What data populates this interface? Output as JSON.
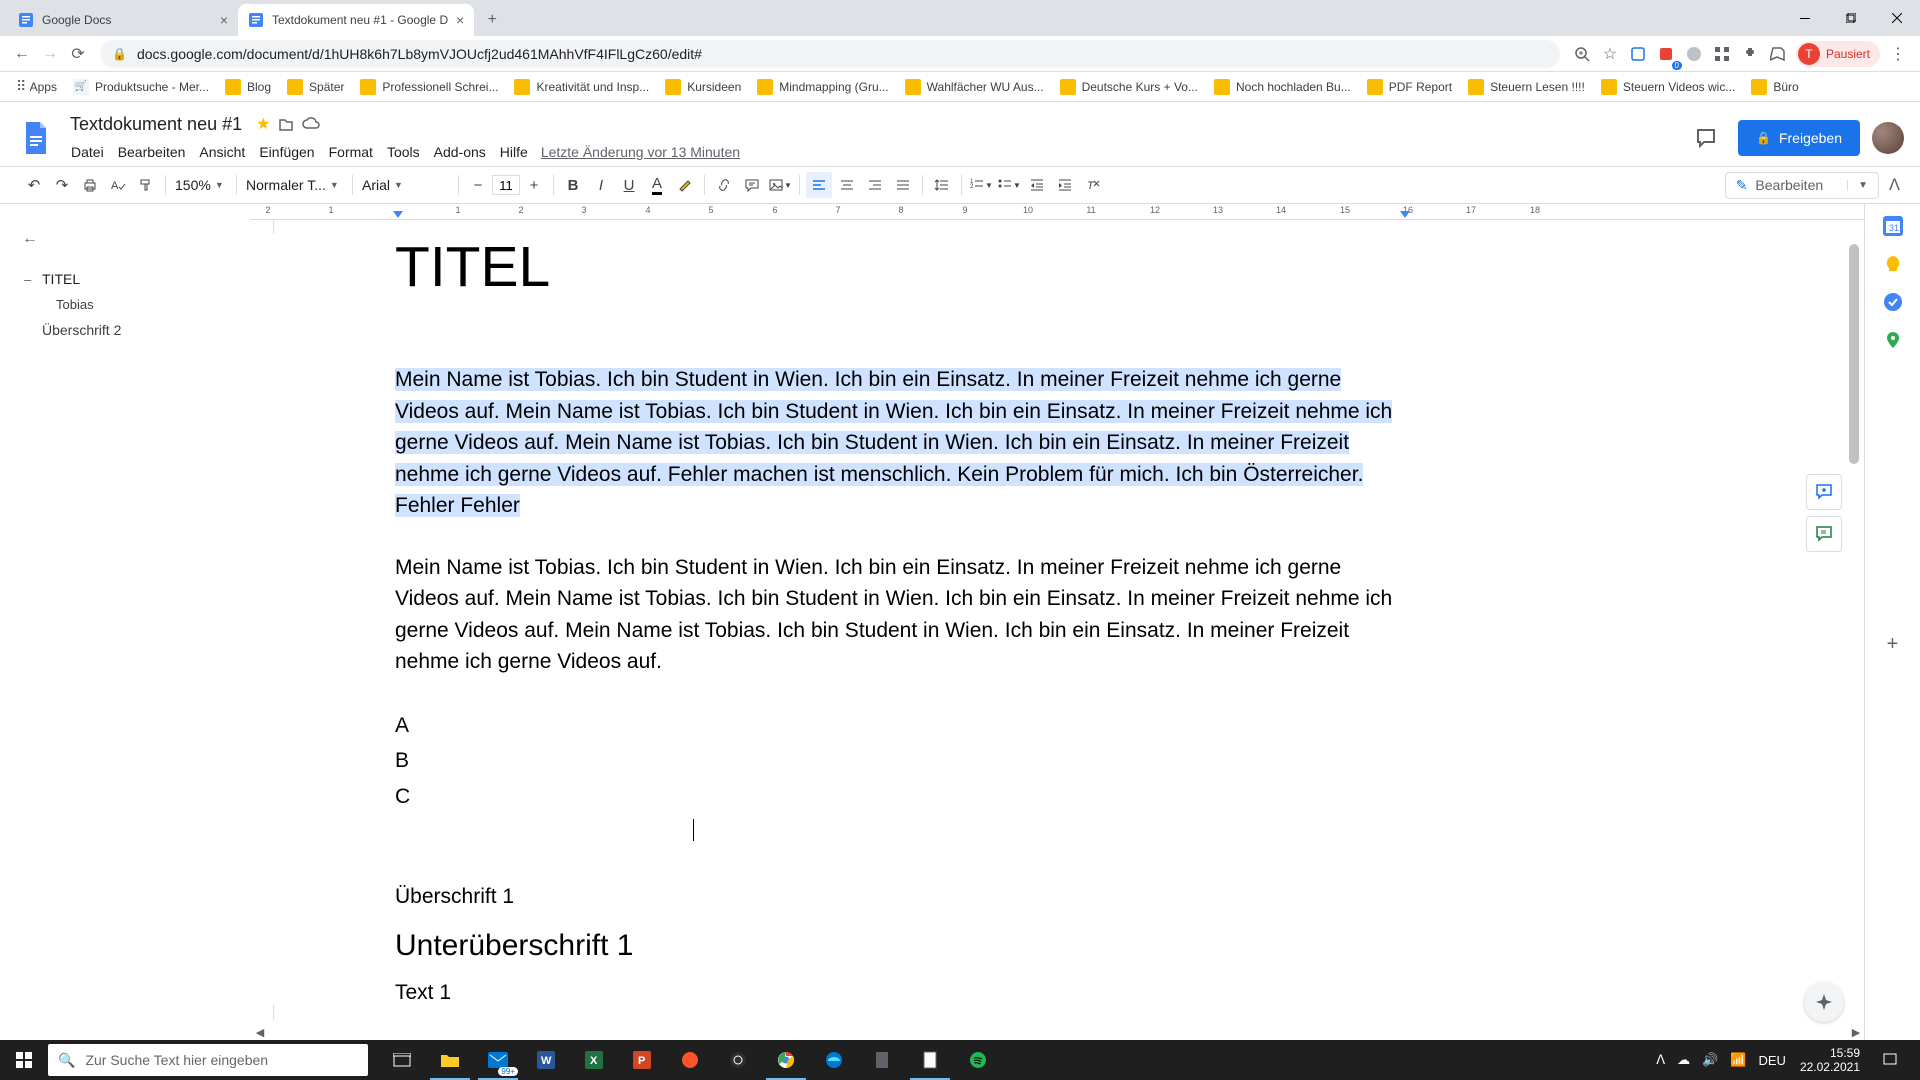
{
  "browser": {
    "tabs": [
      {
        "title": "Google Docs",
        "active": false
      },
      {
        "title": "Textdokument neu #1 - Google D",
        "active": true
      }
    ],
    "url": "docs.google.com/document/d/1hUH8k6h7Lb8ymVJOUcfj2ud461MAhhVfF4IFlLgCz60/edit#",
    "profile_label": "Pausiert",
    "profile_initial": "T"
  },
  "bookmarks": [
    "Apps",
    "Produktsuche - Mer...",
    "Blog",
    "Später",
    "Professionell Schrei...",
    "Kreativität und Insp...",
    "Kursideen",
    "Mindmapping  (Gru...",
    "Wahlfächer WU Aus...",
    "Deutsche Kurs + Vo...",
    "Noch hochladen Bu...",
    "PDF Report",
    "Steuern Lesen !!!!",
    "Steuern Videos wic...",
    "Büro"
  ],
  "docs": {
    "filename": "Textdokument neu #1",
    "share_label": "Freigeben",
    "last_edit": "Letzte Änderung vor 13 Minuten",
    "menus": [
      "Datei",
      "Bearbeiten",
      "Ansicht",
      "Einfügen",
      "Format",
      "Tools",
      "Add-ons",
      "Hilfe"
    ]
  },
  "toolbar": {
    "zoom": "150%",
    "style": "Normaler T...",
    "font": "Arial",
    "font_size": "11",
    "edit_mode": "Bearbeiten"
  },
  "outline": {
    "items": [
      {
        "label": "TITEL",
        "level": 1,
        "expanded": true
      },
      {
        "label": "Tobias",
        "level": 2
      },
      {
        "label": "Überschrift 2",
        "level": 1
      }
    ]
  },
  "ruler": {
    "nums": [
      "2",
      "1",
      "1",
      "2",
      "3",
      "4",
      "5",
      "6",
      "7",
      "8",
      "9",
      "10",
      "11",
      "12",
      "13",
      "14",
      "15",
      "16",
      "17",
      "18"
    ]
  },
  "document": {
    "title": "TITEL",
    "para1": "Mein Name ist Tobias. Ich bin Student in Wien. Ich bin ein Einsatz. In meiner Freizeit nehme ich gerne Videos auf. Mein Name ist Tobias. Ich bin Student in Wien. Ich bin ein Einsatz. In meiner Freizeit nehme ich gerne Videos auf. Mein Name ist Tobias. Ich bin Student in Wien. Ich bin ein Einsatz. In meiner Freizeit nehme ich gerne Videos auf. Fehler machen ist menschlich. Kein Problem für mich. Ich bin Österreicher. Fehler Fehler",
    "para2": "Mein Name ist Tobias. Ich bin Student in Wien. Ich bin ein Einsatz. In meiner Freizeit nehme ich gerne Videos auf. Mein Name ist Tobias. Ich bin Student in Wien. Ich bin ein Einsatz. In meiner Freizeit nehme ich gerne Videos auf. Mein Name ist Tobias. Ich bin Student in Wien. Ich bin ein Einsatz. In meiner Freizeit nehme ich gerne Videos auf.",
    "lines": [
      "A",
      "B",
      "C"
    ],
    "h1": "Überschrift 1",
    "h2": "Unterüberschrift 1",
    "text1": "Text 1"
  },
  "taskbar": {
    "search_placeholder": "Zur Suche Text hier eingeben",
    "lang": "DEU",
    "time": "15:59",
    "date": "22.02.2021"
  }
}
